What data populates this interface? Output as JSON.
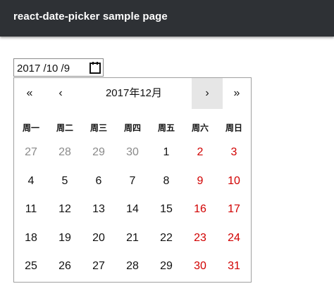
{
  "header": {
    "title": "react-date-picker sample page"
  },
  "date_input": {
    "value": "2017 /10 /9"
  },
  "icons": {
    "calendar_button": "calendar-icon"
  },
  "colors": {
    "topbar": "#2e3135",
    "weekend": "#d10000",
    "neighbor": "#8a8a8a",
    "hover": "#e6e6e6"
  },
  "calendar": {
    "nav": {
      "prev2": "«",
      "prev": "‹",
      "label": "2017年12月",
      "next": "›",
      "next2": "»"
    },
    "weekdays": [
      "周一",
      "周二",
      "周三",
      "周四",
      "周五",
      "周六",
      "周日"
    ],
    "weeks": [
      [
        {
          "d": "27",
          "t": "neighbor"
        },
        {
          "d": "28",
          "t": "neighbor"
        },
        {
          "d": "29",
          "t": "neighbor"
        },
        {
          "d": "30",
          "t": "neighbor"
        },
        {
          "d": "1",
          "t": "normal"
        },
        {
          "d": "2",
          "t": "weekend"
        },
        {
          "d": "3",
          "t": "weekend"
        }
      ],
      [
        {
          "d": "4",
          "t": "normal"
        },
        {
          "d": "5",
          "t": "normal"
        },
        {
          "d": "6",
          "t": "normal"
        },
        {
          "d": "7",
          "t": "normal"
        },
        {
          "d": "8",
          "t": "normal"
        },
        {
          "d": "9",
          "t": "weekend"
        },
        {
          "d": "10",
          "t": "weekend"
        }
      ],
      [
        {
          "d": "11",
          "t": "normal"
        },
        {
          "d": "12",
          "t": "normal"
        },
        {
          "d": "13",
          "t": "normal"
        },
        {
          "d": "14",
          "t": "normal"
        },
        {
          "d": "15",
          "t": "normal"
        },
        {
          "d": "16",
          "t": "weekend"
        },
        {
          "d": "17",
          "t": "weekend"
        }
      ],
      [
        {
          "d": "18",
          "t": "normal"
        },
        {
          "d": "19",
          "t": "normal"
        },
        {
          "d": "20",
          "t": "normal"
        },
        {
          "d": "21",
          "t": "normal"
        },
        {
          "d": "22",
          "t": "normal"
        },
        {
          "d": "23",
          "t": "weekend"
        },
        {
          "d": "24",
          "t": "weekend"
        }
      ],
      [
        {
          "d": "25",
          "t": "normal"
        },
        {
          "d": "26",
          "t": "normal"
        },
        {
          "d": "27",
          "t": "normal"
        },
        {
          "d": "28",
          "t": "normal"
        },
        {
          "d": "29",
          "t": "normal"
        },
        {
          "d": "30",
          "t": "weekend"
        },
        {
          "d": "31",
          "t": "weekend"
        }
      ]
    ]
  }
}
